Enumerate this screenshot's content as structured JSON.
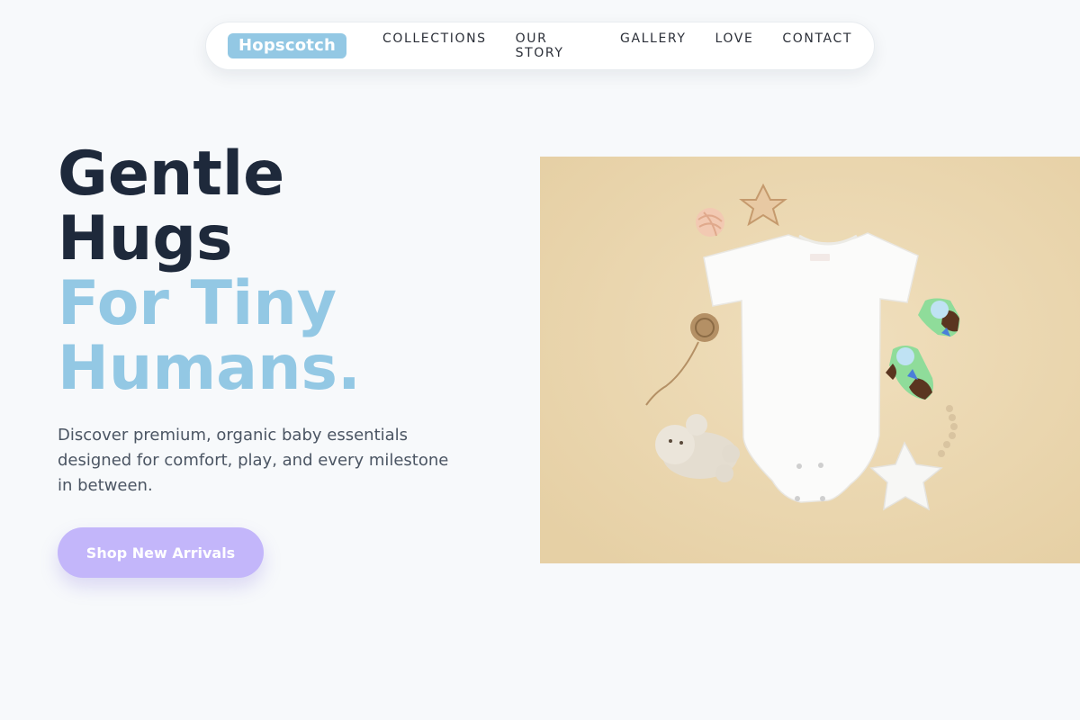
{
  "nav": {
    "brand": "Hopscotch",
    "links": [
      "COLLECTIONS",
      "OUR STORY",
      "GALLERY",
      "LOVE",
      "CONTACT"
    ]
  },
  "hero": {
    "title_line1": "Gentle",
    "title_line2": "Hugs",
    "title_line3": "For Tiny",
    "title_line4": "Humans.",
    "description": "Discover premium, organic baby essentials designed for comfort, play, and every milestone in between.",
    "cta_label": "Shop New Arrivals"
  },
  "colors": {
    "accent_blue": "#93c8e4",
    "cta_purple": "#c3b6fa",
    "heading_dark": "#1e293b",
    "image_bg": "#ecd8b2"
  }
}
